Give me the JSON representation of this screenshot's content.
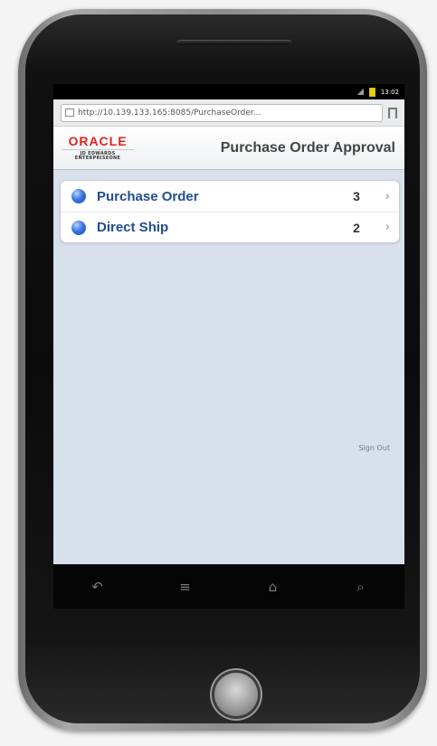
{
  "statusbar": {
    "time": "13:02"
  },
  "browser": {
    "url": "http://10.139.133.165:8085/PurchaseOrder..."
  },
  "header": {
    "logo_brand": "ORACLE",
    "logo_sub": "JD EDWARDS ENTERPRISEONE",
    "title": "Purchase Order Approval"
  },
  "list": [
    {
      "label": "Purchase Order",
      "count": "3",
      "chevron": "›"
    },
    {
      "label": "Direct Ship",
      "count": "2",
      "chevron": "›"
    }
  ],
  "footer": {
    "signout": "Sign Out"
  },
  "nav": {
    "back": "↶",
    "menu": "≡",
    "home": "⌂",
    "search": "⌕"
  },
  "colors": {
    "brand_red": "#e2241b",
    "link_blue": "#234c92",
    "screen_bg": "#d8e0ec"
  }
}
